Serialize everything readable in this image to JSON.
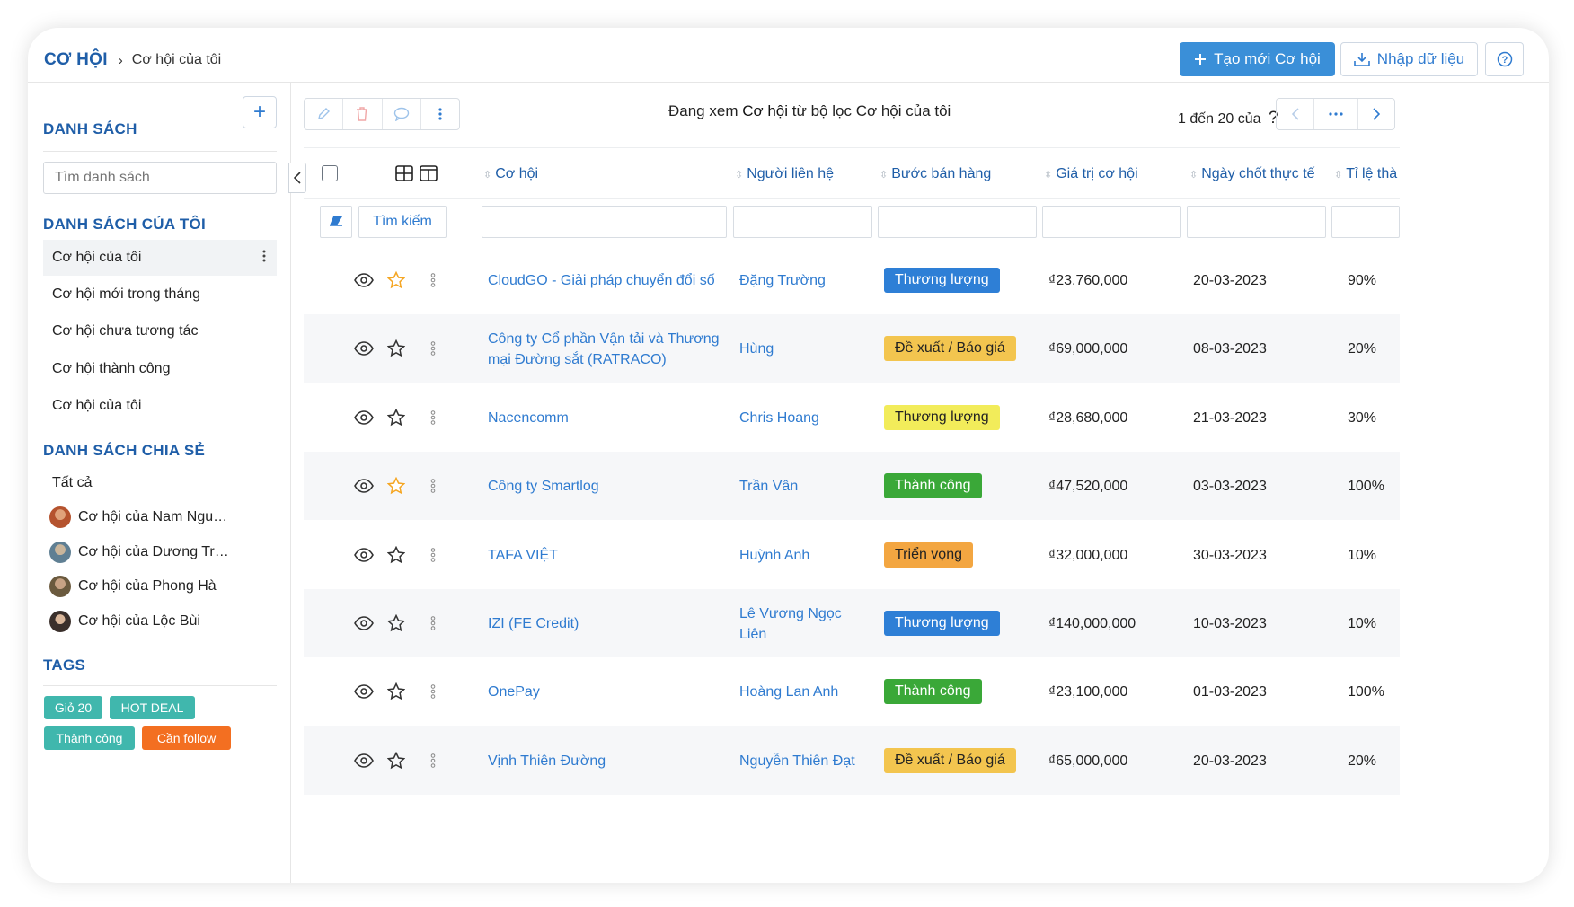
{
  "header": {
    "root": "CƠ HỘI",
    "current": "Cơ hội của tôi",
    "create_label": "Tạo mới Cơ hội",
    "import_label": "Nhập dữ liệu",
    "icons": [
      "plus-icon",
      "download-icon",
      "help-icon"
    ]
  },
  "sidebar": {
    "list_title": "DANH SÁCH",
    "search_placeholder": "Tìm danh sách",
    "my_lists_title": "DANH SÁCH CỦA TÔI",
    "my_lists": [
      "Cơ hội của tôi",
      "Cơ hội mới trong tháng",
      "Cơ hội chưa tương tác",
      "Cơ hội thành công",
      "Cơ hội của tôi"
    ],
    "shared_title": "DANH SÁCH CHIA SẺ",
    "shared": [
      {
        "label": "Tất cả"
      },
      {
        "label": "Cơ hội của Nam Ngu…",
        "color": "#b5532e"
      },
      {
        "label": "Cơ hội của Dương Tr…",
        "color": "#5f7f93"
      },
      {
        "label": "Cơ hội của Phong Hà",
        "color": "#6b5a3e"
      },
      {
        "label": "Cơ hội của Lộc Bùi",
        "color": "#3a2f2b"
      }
    ],
    "tags_title": "TAGS",
    "tags": [
      {
        "label": "Giỏ 20",
        "color": "#40b7ad"
      },
      {
        "label": "HOT DEAL",
        "color": "#40b7ad"
      },
      {
        "label": "Thành công",
        "color": "#40b7ad"
      },
      {
        "label": "Cần follow",
        "color": "#f36f21"
      }
    ]
  },
  "main": {
    "viewing_prefix": "Đang xem ",
    "viewing_entity": "Cơ hội",
    "viewing_middle": " từ bộ lọc ",
    "viewing_filter": "Cơ hội của tôi",
    "pager_text": "1 đến 20 của",
    "pager_q": "?",
    "search_label": "Tìm kiếm",
    "columns": [
      "Cơ hội",
      "Người liên hệ",
      "Bước bán hàng",
      "Giá trị cơ hội",
      "Ngày chốt thực tế",
      "Tỉ lệ thà"
    ],
    "rows": [
      {
        "name": "CloudGO - Giải pháp chuyển đổi số",
        "contact": "Đặng Trường",
        "stage": "Thương lượng",
        "stage_kind": "blue",
        "value": "₫23,760,000",
        "date": "20-03-2023",
        "rate": "90%",
        "starred": true
      },
      {
        "name": "Công ty Cổ phần Vận tải và Thương mại Đường sắt (RATRACO)",
        "contact": "Hùng",
        "stage": "Đề xuất / Báo giá",
        "stage_kind": "gold",
        "value": "₫69,000,000",
        "date": "08-03-2023",
        "rate": "20%",
        "starred": false
      },
      {
        "name": "Nacencomm",
        "contact": "Chris Hoang",
        "stage": "Thương lượng",
        "stage_kind": "yellow",
        "value": "₫28,680,000",
        "date": "21-03-2023",
        "rate": "30%",
        "starred": false
      },
      {
        "name": "Công ty Smartlog",
        "contact": "Trần Vân",
        "stage": "Thành công",
        "stage_kind": "green",
        "value": "₫47,520,000",
        "date": "03-03-2023",
        "rate": "100%",
        "starred": true
      },
      {
        "name": "TAFA VIỆT",
        "contact": "Huỳnh Anh",
        "stage": "Triển vọng",
        "stage_kind": "orange",
        "value": "₫32,000,000",
        "date": "30-03-2023",
        "rate": "10%",
        "starred": false
      },
      {
        "name": "IZI (FE Credit)",
        "contact": "Lê Vương Ngọc Liên",
        "stage": "Thương lượng",
        "stage_kind": "blue",
        "value": "₫140,000,000",
        "date": "10-03-2023",
        "rate": "10%",
        "starred": false
      },
      {
        "name": "OnePay",
        "contact": "Hoàng Lan Anh",
        "stage": "Thành công",
        "stage_kind": "green",
        "value": "₫23,100,000",
        "date": "01-03-2023",
        "rate": "100%",
        "starred": false
      },
      {
        "name": "Vịnh Thiên Đường",
        "contact": "Nguyễn Thiên Đạt",
        "stage": "Đề xuất / Báo giá",
        "stage_kind": "gold",
        "value": "₫65,000,000",
        "date": "20-03-2023",
        "rate": "20%",
        "starred": false
      }
    ],
    "stage_colors": {
      "blue": {
        "bg": "#2e7fd6",
        "fg": "#ffffff"
      },
      "gold": {
        "bg": "#f3c54f",
        "fg": "#222222"
      },
      "yellow": {
        "bg": "#f2ec5a",
        "fg": "#222222"
      },
      "green": {
        "bg": "#3aa838",
        "fg": "#ffffff"
      },
      "orange": {
        "bg": "#f3a641",
        "fg": "#222222"
      }
    },
    "star_color": "#f5a623"
  }
}
